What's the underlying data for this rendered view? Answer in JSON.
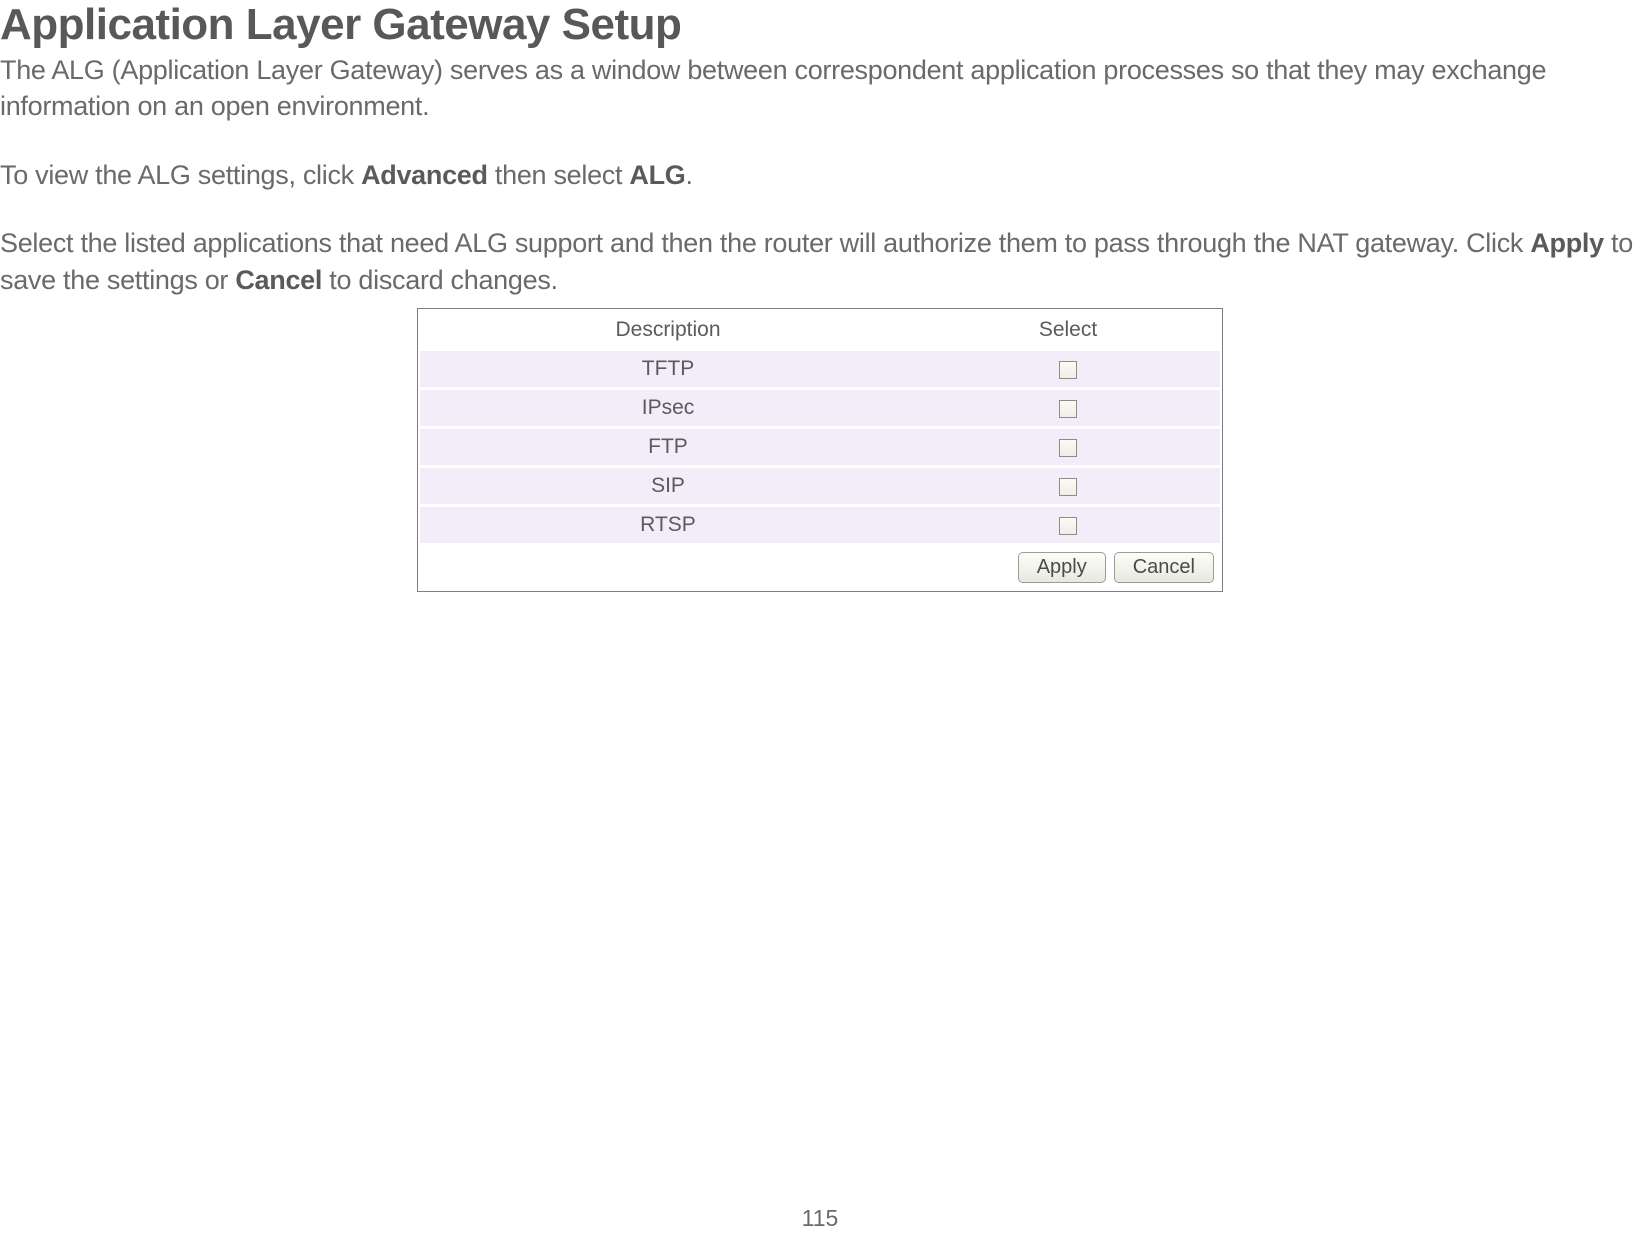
{
  "title": "Application Layer Gateway Setup",
  "para1_a": "The ALG (Application Layer Gateway) serves as a window between correspondent application processes so that they may exchange information on an open environment.",
  "para2_a": "To view the ALG settings, click ",
  "para2_b": "Advanced",
  "para2_c": " then select ",
  "para2_d": "ALG",
  "para2_e": ".",
  "para3_a": "Select the listed applications that need ALG support and then the router will authorize them to pass through the NAT gateway. Click ",
  "para3_b": "Apply",
  "para3_c": " to save the settings or ",
  "para3_d": "Cancel",
  "para3_e": " to discard changes.",
  "table": {
    "headers": {
      "description": "Description",
      "select": "Select"
    },
    "rows": [
      {
        "name": "TFTP",
        "checked": false
      },
      {
        "name": "IPsec",
        "checked": false
      },
      {
        "name": "FTP",
        "checked": false
      },
      {
        "name": "SIP",
        "checked": false
      },
      {
        "name": "RTSP",
        "checked": false
      }
    ]
  },
  "buttons": {
    "apply": "Apply",
    "cancel": "Cancel"
  },
  "page_number": "115"
}
